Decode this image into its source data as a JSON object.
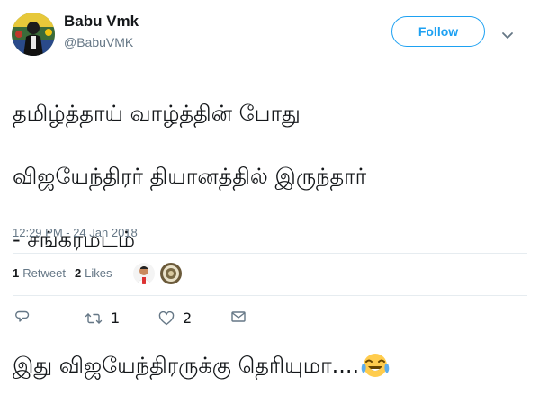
{
  "user": {
    "display_name": "Babu Vmk",
    "handle": "@BabuVMK",
    "avatar_icon": "profile-photo"
  },
  "follow_label": "Follow",
  "tweet": {
    "line1": "தமிழ்த்தாய் வாழ்த்தின் போது",
    "line2": "விஜயேந்திரர் தியானத்தில் இருந்தார்",
    "line3": "- சங்கரமடம்",
    "line4": "இது விஜயேந்திரருக்கு தெரியுமா....",
    "emoji_icon": "face-with-tears-of-joy-emoji"
  },
  "timestamp": "12:29 PM - 24 Jan 2018",
  "stats": {
    "retweets_count": "1",
    "retweets_label": "Retweet",
    "likes_count": "2",
    "likes_label": "Likes"
  },
  "actions": {
    "reply_icon": "reply-icon",
    "retweet_icon": "retweet-icon",
    "retweet_count": "1",
    "like_icon": "heart-icon",
    "like_count": "2",
    "dm_icon": "envelope-icon"
  },
  "colors": {
    "accent": "#1da1f2",
    "text": "#14171a",
    "muted": "#657786",
    "divider": "#e6ecf0"
  }
}
